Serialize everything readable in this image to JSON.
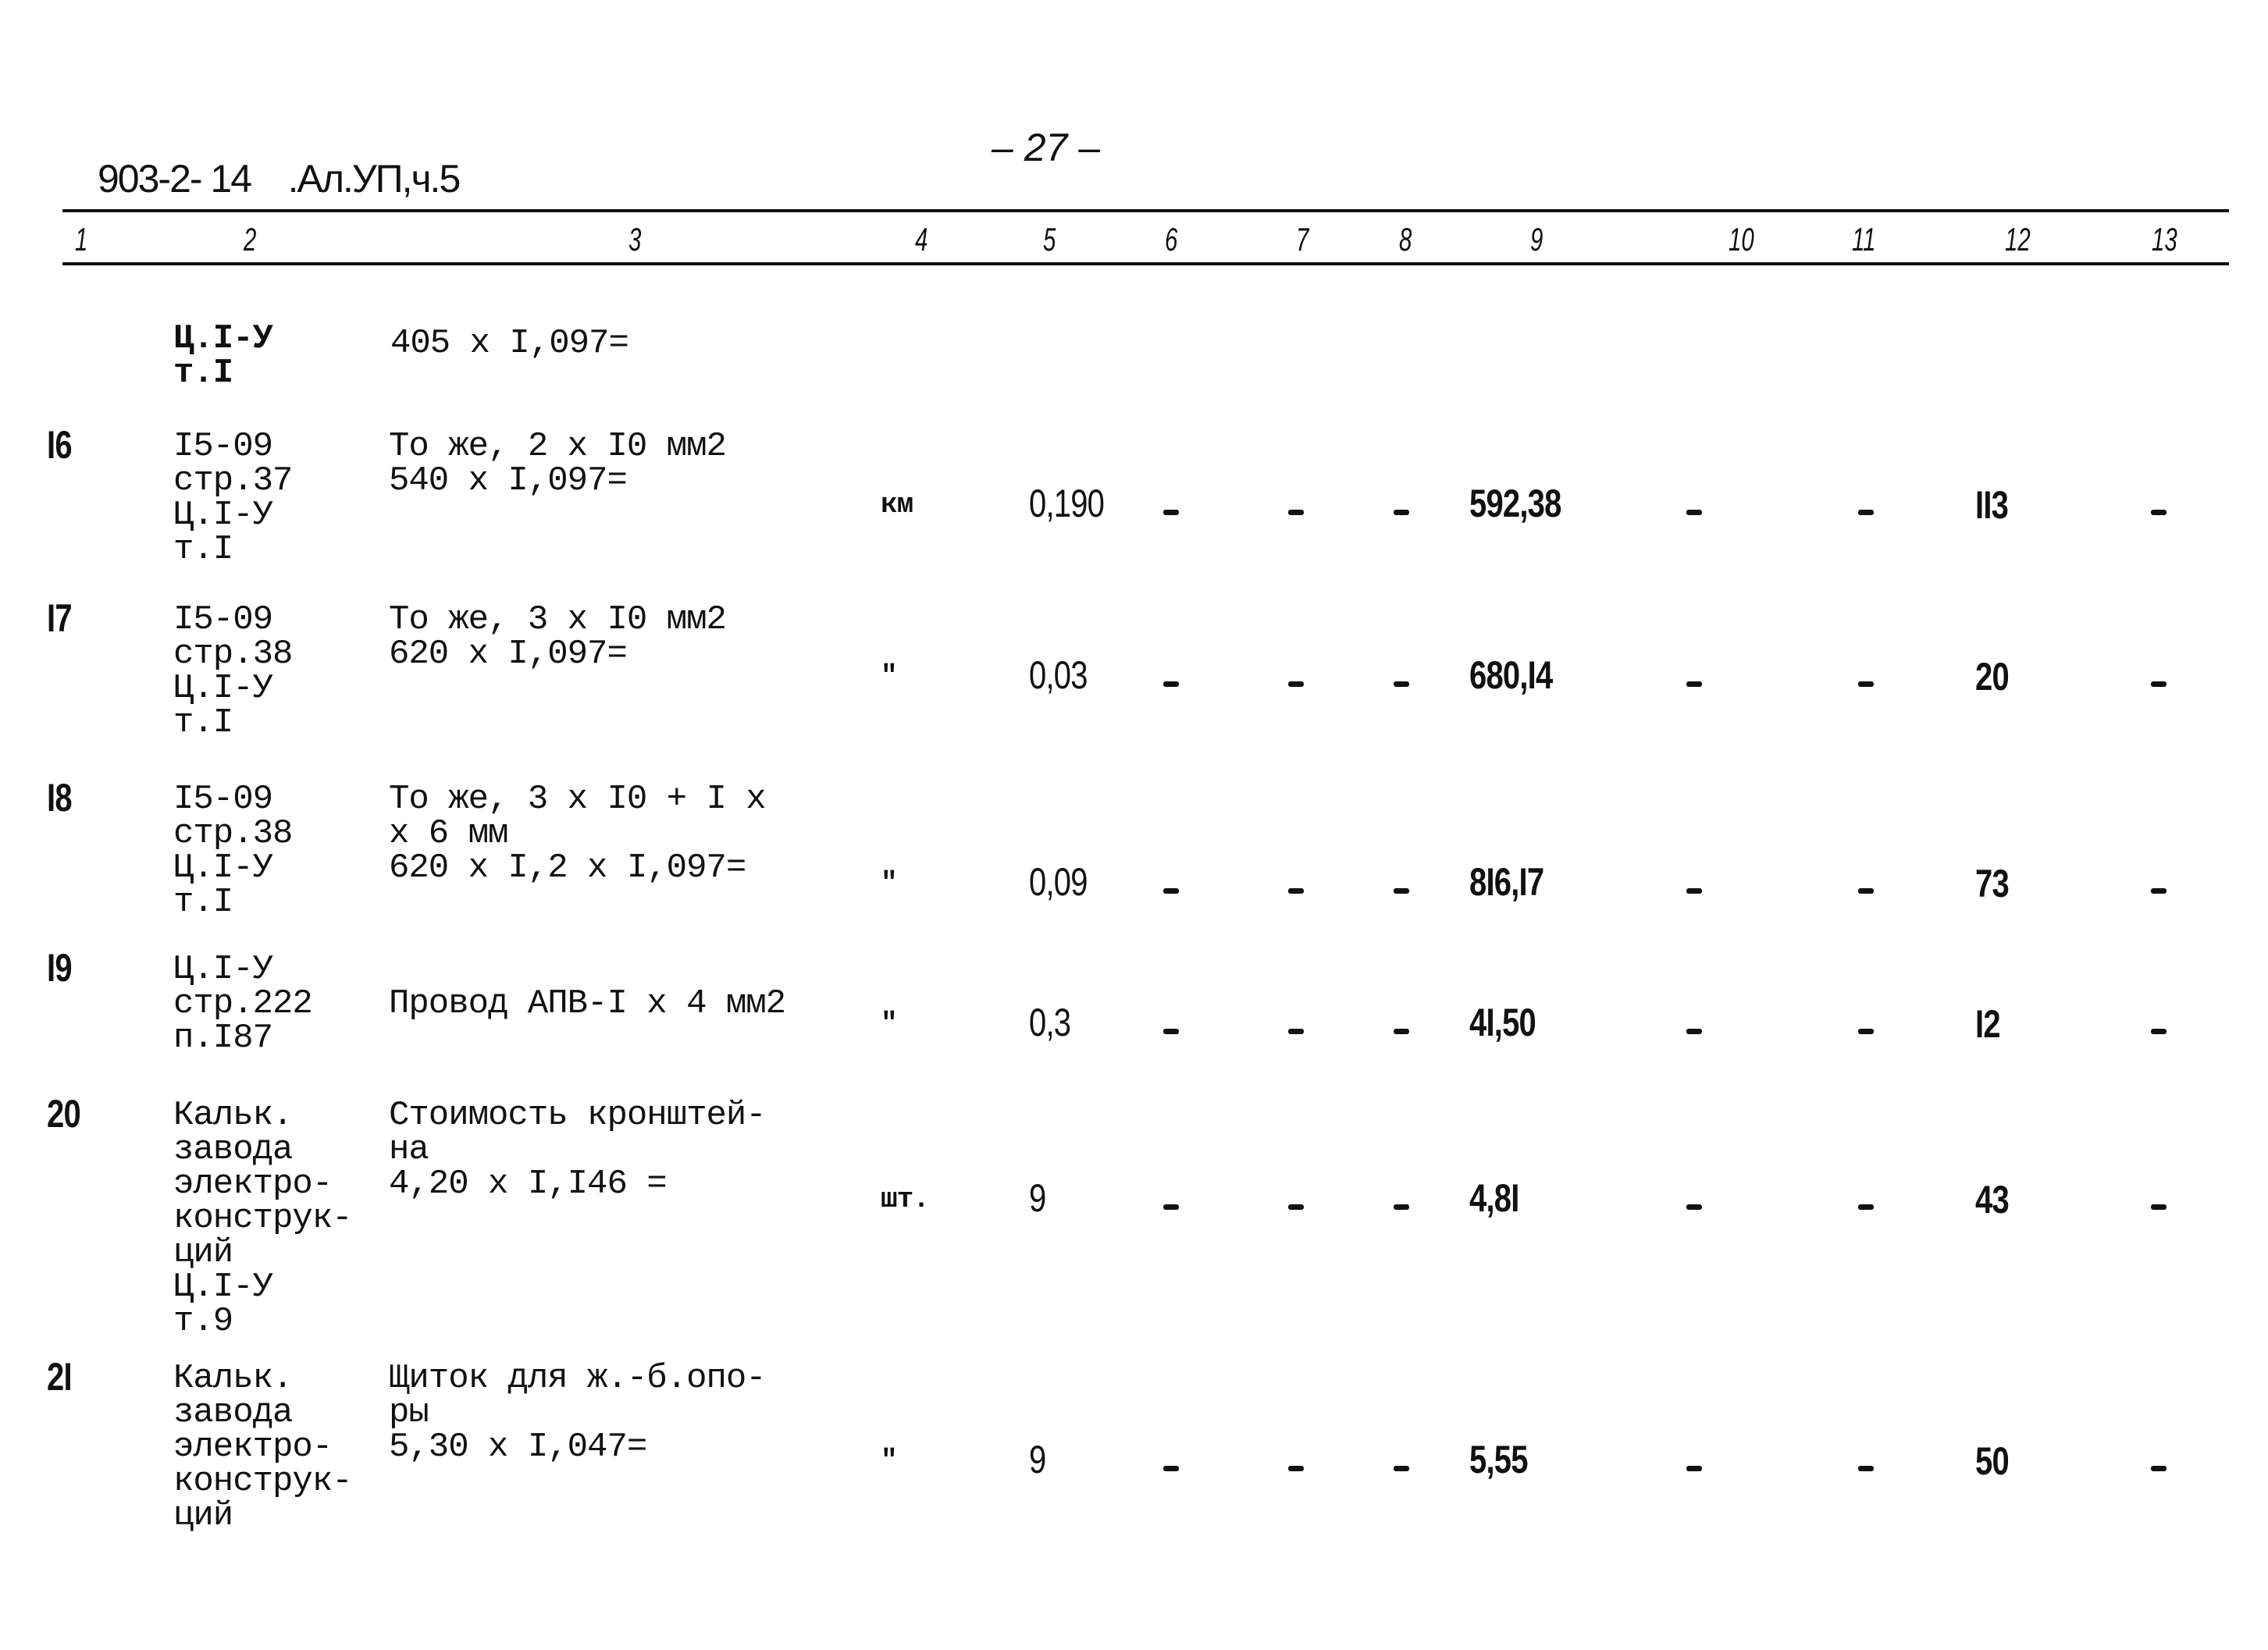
{
  "header": {
    "doc_code": "903-2- 14    .Ал.УП,ч.5",
    "page_number": "– 27 –"
  },
  "columns": [
    "1",
    "2",
    "3",
    "4",
    "5",
    "6",
    "7",
    "8",
    "9",
    "10",
    "11",
    "12",
    "13"
  ],
  "carry_over": {
    "ref": "Ц.I-У\nт.I",
    "desc": "405 x I,097="
  },
  "rows": [
    {
      "n": "I6",
      "ref": "I5-09\nстр.37\nЦ.I-У\nт.I",
      "desc": "То же, 2 x I0 мм2\n540 x I,097=",
      "unit": "км",
      "qty": "0,190",
      "c6": "–",
      "c7": "–",
      "c8": "–",
      "price": "592,38",
      "c10": "–",
      "c11": "–",
      "c12": "II3",
      "c13": "–"
    },
    {
      "n": "I7",
      "ref": "I5-09\nстр.38\nЦ.I-У\nт.I",
      "desc": "То же, 3 x I0 мм2\n620 x I,097=",
      "unit": "\"",
      "qty": "0,03",
      "c6": "–",
      "c7": "–",
      "c8": "–",
      "price": "680,I4",
      "c10": "–",
      "c11": "–",
      "c12": "20",
      "c13": "–"
    },
    {
      "n": "I8",
      "ref": "I5-09\nстр.38\nЦ.I-У\nт.I",
      "desc": "То же, 3 x I0 + I x\nx 6 мм\n620 x I,2 x I,097=",
      "unit": "\"",
      "qty": "0,09",
      "c6": "–",
      "c7": "–",
      "c8": "–",
      "price": "8I6,I7",
      "c10": "–",
      "c11": "–",
      "c12": "73",
      "c13": "–"
    },
    {
      "n": "I9",
      "ref": "Ц.I-У\nстр.222\nп.I87",
      "desc": "\nПровод АПВ-I x 4 мм2",
      "unit": "\"",
      "qty": "0,3",
      "c6": "–",
      "c7": "–",
      "c8": "–",
      "price": "4I,50",
      "c10": "–",
      "c11": "–",
      "c12": "I2",
      "c13": "–"
    },
    {
      "n": "20",
      "ref": "Кальк.\nзавода\nэлектро-\nконструк-\nций\nЦ.I-У\nт.9",
      "desc": "Стоимость кронштей-\nна\n4,20 x I,I46 =",
      "unit": "шт.",
      "qty": "9",
      "c6": "–",
      "c7": "–",
      "c8": "–",
      "price": "4,8I",
      "c10": "–",
      "c11": "–",
      "c12": "43",
      "c13": "–"
    },
    {
      "n": "2I",
      "ref": "Кальк.\nзавода\nэлектро-\nконструк-\nций",
      "desc": "Щиток для ж.-б.опо-\nры\n5,30 x I,047=",
      "unit": "\"",
      "qty": "9",
      "c6": "–",
      "c7": "–",
      "c8": "–",
      "price": "5,55",
      "c10": "–",
      "c11": "–",
      "c12": "50",
      "c13": "–"
    }
  ]
}
